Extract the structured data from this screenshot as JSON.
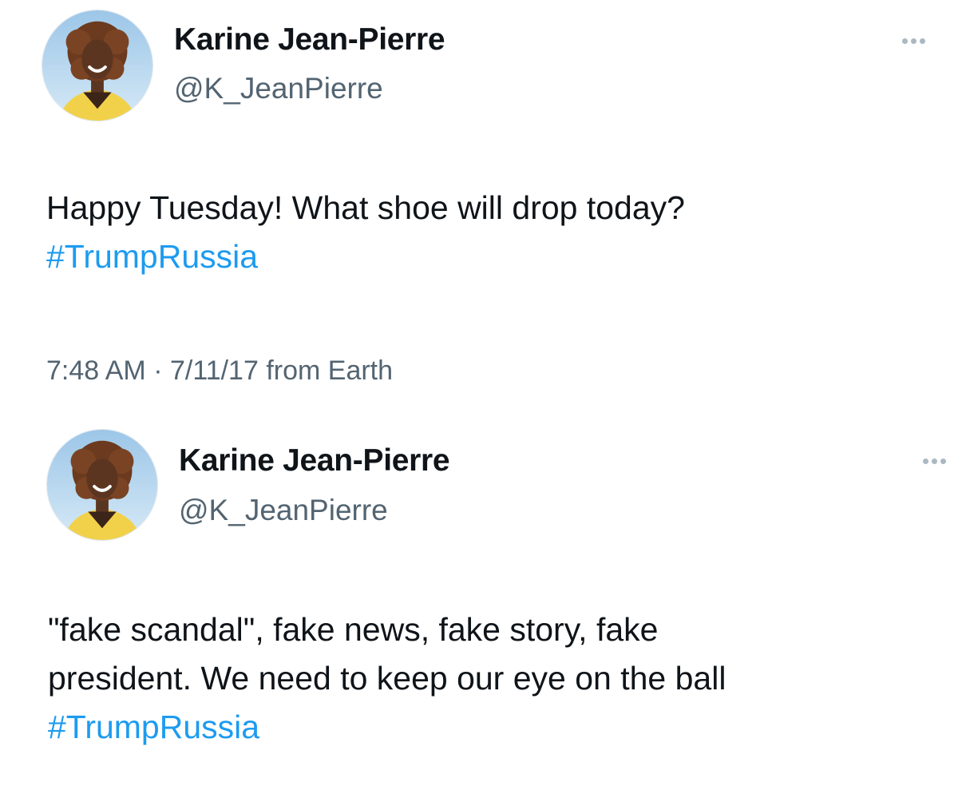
{
  "colors": {
    "text": "#0f1419",
    "secondary": "#536471",
    "link": "#1d9bf0",
    "background": "#ffffff"
  },
  "tweets": [
    {
      "author": {
        "name": "Karine Jean-Pierre",
        "handle": "@K_JeanPierre",
        "avatar_icon": "profile-photo"
      },
      "more_icon": "more-dots-icon",
      "text_lines": [
        "Happy Tuesday! What shoe will drop today?"
      ],
      "hashtag": "#TrumpRussia",
      "meta": "7:48 AM · 7/11/17 from Earth"
    },
    {
      "author": {
        "name": "Karine Jean-Pierre",
        "handle": "@K_JeanPierre",
        "avatar_icon": "profile-photo"
      },
      "more_icon": "more-dots-icon",
      "text_lines": [
        "\"fake scandal\", fake news, fake story, fake",
        "president. We need to keep our eye on the ball"
      ],
      "hashtag": "#TrumpRussia"
    }
  ]
}
